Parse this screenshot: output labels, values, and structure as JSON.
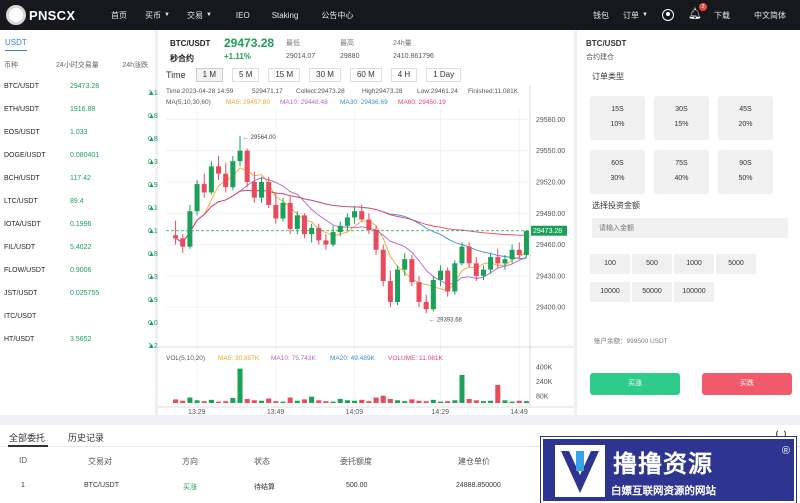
{
  "brand": {
    "logo_text": "PNSCX"
  },
  "nav": {
    "items": [
      "首页",
      "买币",
      "交易",
      "IEO",
      "Staking",
      "公告中心"
    ],
    "right": {
      "wallet": "钱包",
      "orders": "订单",
      "notify_count": "2",
      "download": "下载",
      "language": "中文简体"
    }
  },
  "market": {
    "tab": "USDT",
    "headers": {
      "symbol": "币种",
      "volume": "24小时交易量",
      "change": "24h涨跌"
    },
    "rows": [
      {
        "symbol": "BTC/USDT",
        "volume": "29473.28",
        "change": "1.11%"
      },
      {
        "symbol": "ETH/USDT",
        "volume": "1916.88",
        "change": "0.83%"
      },
      {
        "symbol": "EOS/USDT",
        "volume": "1.033",
        "change": "0.81%"
      },
      {
        "symbol": "DOGE/USDT",
        "volume": "0.080401",
        "change": "0.31%"
      },
      {
        "symbol": "BCH/USDT",
        "volume": "117.42",
        "change": "0.95%"
      },
      {
        "symbol": "LTC/USDT",
        "volume": "89.4",
        "change": "0.15%"
      },
      {
        "symbol": "IOTA/USDT",
        "volume": "0.1996",
        "change": "0.15%"
      },
      {
        "symbol": "FIL/USDT",
        "volume": "5.4022",
        "change": "0.84%"
      },
      {
        "symbol": "FLOW/USDT",
        "volume": "0.9006",
        "change": "0.38%"
      },
      {
        "symbol": "JST/USDT",
        "volume": "0.025755",
        "change": "0.95%"
      },
      {
        "symbol": "ITC/USDT",
        "volume": "",
        "change": "0.00%"
      },
      {
        "symbol": "HT/USDT",
        "volume": "3.5652",
        "change": "1.27%"
      }
    ]
  },
  "ticker": {
    "pair": "BTC/USDT",
    "contract": "秒合约",
    "price": "29473.28",
    "change": "+1.11%",
    "low_label": "最低",
    "low": "29014.07",
    "high_label": "最高",
    "high": "29880",
    "vol_label": "24h量",
    "vol": "2410.861796"
  },
  "timeframes": {
    "label": "Time",
    "buttons": [
      "1 M",
      "5 M",
      "15 M",
      "30 M",
      "60 M",
      "4 H",
      "1 Day"
    ],
    "active": 0
  },
  "overlay": {
    "info": [
      "Time:2023-04-28 14:59",
      "529471.17",
      "Collect:29473.28",
      "High29473.28",
      "Low:29461.24",
      "Finished:11.081K"
    ],
    "ma_label": "MA(5,10,30,60)",
    "ma5": "MA5: 29457.80",
    "ma10": "MA10: 29448.48",
    "ma30": "MA30: 29436.69",
    "ma60": "MA60: 29450.19",
    "vol_label": "VOL(5,10,20)",
    "vma5": "MA5: 30.857K",
    "vma10": "MA10: 75.743K",
    "vma20": "MA20: 49.489K",
    "volume": "VOLUME: 11.081K",
    "max_label": "29564.00",
    "min_label": "29393.68",
    "last_label": "29473.28"
  },
  "chart_data": {
    "type": "candlestick",
    "y_ticks": [
      "29580.00",
      "29550.00",
      "29520.00",
      "29490.00",
      "29460.00",
      "29430.00",
      "29400.00"
    ],
    "vol_ticks": [
      "400K",
      "240K",
      "80K"
    ],
    "x_ticks": [
      "13:29",
      "13:49",
      "14:09",
      "14:29",
      "14:49"
    ],
    "ylim": [
      29380,
      29590
    ],
    "last": 29473.28,
    "candles": [
      [
        29469,
        29483,
        29460,
        29466
      ],
      [
        29466,
        29470,
        29452,
        29458
      ],
      [
        29458,
        29498,
        29456,
        29492
      ],
      [
        29492,
        29522,
        29488,
        29518
      ],
      [
        29518,
        29528,
        29505,
        29510
      ],
      [
        29510,
        29540,
        29508,
        29535
      ],
      [
        29535,
        29545,
        29522,
        29528
      ],
      [
        29528,
        29538,
        29510,
        29515
      ],
      [
        29515,
        29545,
        29512,
        29540
      ],
      [
        29540,
        29564,
        29535,
        29550
      ],
      [
        29550,
        29552,
        29515,
        29520
      ],
      [
        29520,
        29530,
        29500,
        29505
      ],
      [
        29505,
        29525,
        29500,
        29520
      ],
      [
        29520,
        29525,
        29495,
        29498
      ],
      [
        29498,
        29510,
        29480,
        29485
      ],
      [
        29485,
        29505,
        29482,
        29500
      ],
      [
        29500,
        29506,
        29470,
        29475
      ],
      [
        29475,
        29492,
        29470,
        29488
      ],
      [
        29488,
        29490,
        29466,
        29470
      ],
      [
        29470,
        29480,
        29462,
        29476
      ],
      [
        29476,
        29480,
        29460,
        29464
      ],
      [
        29464,
        29470,
        29455,
        29460
      ],
      [
        29460,
        29478,
        29458,
        29472
      ],
      [
        29472,
        29482,
        29468,
        29478
      ],
      [
        29478,
        29490,
        29474,
        29486
      ],
      [
        29486,
        29496,
        29480,
        29492
      ],
      [
        29492,
        29498,
        29482,
        29484
      ],
      [
        29484,
        29490,
        29470,
        29474
      ],
      [
        29474,
        29478,
        29450,
        29455
      ],
      [
        29455,
        29460,
        29420,
        29425
      ],
      [
        29425,
        29435,
        29400,
        29405
      ],
      [
        29405,
        29440,
        29402,
        29436
      ],
      [
        29436,
        29452,
        29430,
        29446
      ],
      [
        29446,
        29450,
        29420,
        29424
      ],
      [
        29424,
        29430,
        29400,
        29405
      ],
      [
        29405,
        29412,
        29394,
        29398
      ],
      [
        29398,
        29430,
        29396,
        29426
      ],
      [
        29426,
        29440,
        29420,
        29435
      ],
      [
        29435,
        29438,
        29410,
        29415
      ],
      [
        29415,
        29445,
        29412,
        29442
      ],
      [
        29442,
        29462,
        29440,
        29458
      ],
      [
        29458,
        29462,
        29438,
        29442
      ],
      [
        29442,
        29448,
        29425,
        29430
      ],
      [
        29430,
        29440,
        29426,
        29436
      ],
      [
        29436,
        29452,
        29432,
        29448
      ],
      [
        29448,
        29456,
        29438,
        29442
      ],
      [
        29442,
        29450,
        29436,
        29446
      ],
      [
        29446,
        29460,
        29442,
        29455
      ],
      [
        29455,
        29462,
        29446,
        29450
      ],
      [
        29450,
        29474,
        29448,
        29473
      ]
    ],
    "volumes": [
      40,
      25,
      60,
      30,
      20,
      35,
      15,
      20,
      55,
      380,
      45,
      30,
      25,
      50,
      20,
      15,
      60,
      25,
      40,
      70,
      30,
      20,
      15,
      45,
      30,
      25,
      35,
      20,
      60,
      80,
      45,
      30,
      20,
      40,
      25,
      20,
      35,
      15,
      20,
      30,
      310,
      45,
      30,
      20,
      25,
      200,
      30,
      15,
      25,
      20
    ]
  },
  "trade": {
    "title": "BTC/USDT",
    "sub": "合约建仓",
    "type_label": "订单类型",
    "options": [
      {
        "time": "15S",
        "rate": "10%"
      },
      {
        "time": "30S",
        "rate": "15%"
      },
      {
        "time": "45S",
        "rate": "20%"
      },
      {
        "time": "60S",
        "rate": "30%"
      },
      {
        "time": "75S",
        "rate": "40%"
      },
      {
        "time": "90S",
        "rate": "50%"
      }
    ],
    "amount_label": "选择投资金额",
    "amount_placeholder": "请输入金额",
    "amounts": [
      "100",
      "500",
      "1000",
      "5000",
      "10000",
      "50000",
      "100000"
    ],
    "balance": "账户余额：999500 USDT",
    "buy": "买涨",
    "sell": "买跌"
  },
  "orders": {
    "tabs": [
      "全部委托",
      "历史记录"
    ],
    "headers": [
      "ID",
      "交易对",
      "方向",
      "状态",
      "委托额度",
      "建仓单价"
    ],
    "rows": [
      {
        "id": "1",
        "pair": "BTC/USDT",
        "dir": "买涨",
        "status": "待结算",
        "amount": "500.00",
        "price": "24888.850000"
      }
    ]
  },
  "watermark": {
    "title": "撸撸资源",
    "reg": "®",
    "subtitle": "白嫖互联网资源的网站"
  },
  "colors": {
    "up": "#1aa058",
    "down": "#e94b5c",
    "ma5": "#f5a623",
    "ma10": "#b561c9",
    "ma30": "#3a8fd9",
    "ma60": "#e0476a"
  }
}
